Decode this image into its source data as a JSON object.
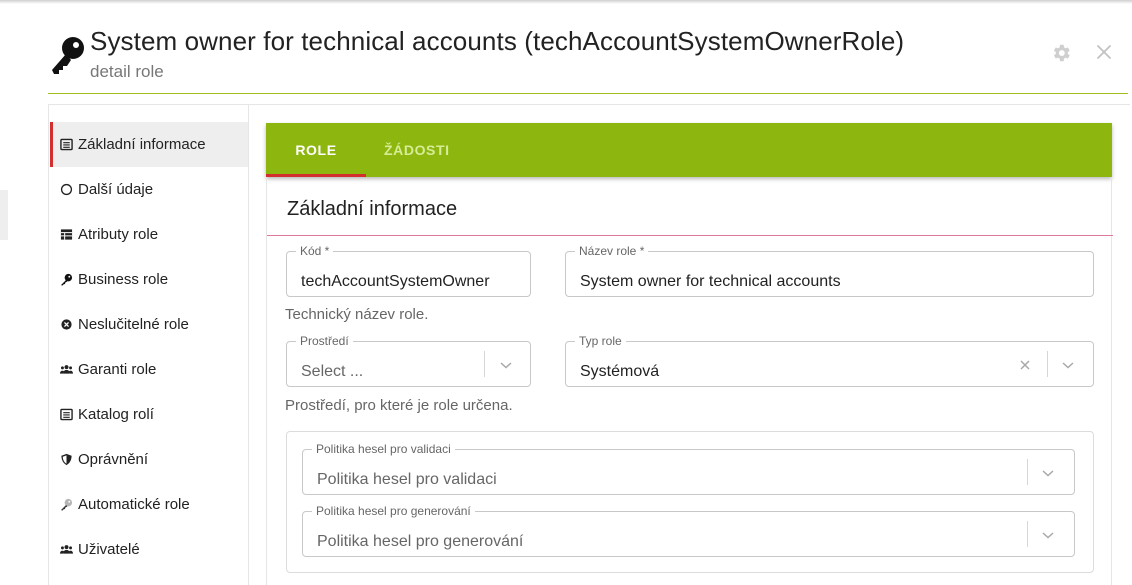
{
  "header": {
    "title": "System owner for technical accounts (techAccountSystemOwnerRole)",
    "subtitle": "detail role"
  },
  "sidebar": {
    "items": [
      {
        "label": "Základní informace",
        "icon": "list-alt-icon",
        "active": true
      },
      {
        "label": "Další údaje",
        "icon": "circle-outline-icon"
      },
      {
        "label": "Atributy role",
        "icon": "table-icon"
      },
      {
        "label": "Business role",
        "icon": "key-icon"
      },
      {
        "label": "Neslučitelné role",
        "icon": "remove-circle-icon"
      },
      {
        "label": "Garanti role",
        "icon": "users-icon"
      },
      {
        "label": "Katalog rolí",
        "icon": "list-alt-icon"
      },
      {
        "label": "Oprávnění",
        "icon": "shield-icon"
      },
      {
        "label": "Automatické role",
        "icon": "key-gray-icon"
      },
      {
        "label": "Uživatelé",
        "icon": "users-icon"
      }
    ]
  },
  "tabs": {
    "role": "ROLE",
    "zadosti": "ŽÁDOSTI"
  },
  "section": {
    "title": "Základní informace"
  },
  "form": {
    "kod": {
      "label": "Kód *",
      "value": "techAccountSystemOwner",
      "helper": "Technický název role."
    },
    "nazev": {
      "label": "Název role *",
      "value": "System owner for technical accounts"
    },
    "prostredi": {
      "label": "Prostředí",
      "placeholder": "Select ...",
      "helper": "Prostředí, pro které je role určena."
    },
    "typ": {
      "label": "Typ role",
      "value": "Systémová"
    },
    "validace": {
      "label": "Politika hesel pro validaci",
      "placeholder": "Politika hesel pro validaci"
    },
    "generovani": {
      "label": "Politika hesel pro generování",
      "placeholder": "Politika hesel pro generování"
    }
  },
  "colors": {
    "accent_green": "#8db60f",
    "accent_red": "#d32f2f"
  }
}
